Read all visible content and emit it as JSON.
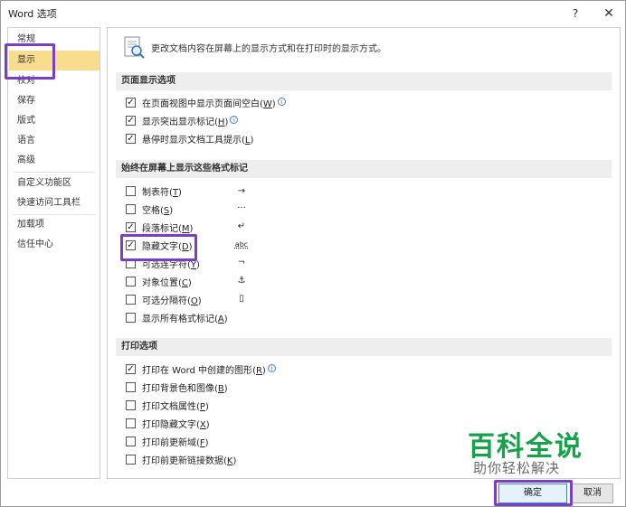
{
  "window": {
    "title": "Word 选项",
    "help_label": "?",
    "close_label": "✕"
  },
  "sidebar": {
    "items": [
      {
        "label": "常规"
      },
      {
        "label": "显示"
      },
      {
        "label": "校对"
      },
      {
        "label": "保存"
      },
      {
        "label": "版式"
      },
      {
        "label": "语言"
      },
      {
        "label": "高级"
      },
      {
        "label": "自定义功能区"
      },
      {
        "label": "快速访问工具栏"
      },
      {
        "label": "加载项"
      },
      {
        "label": "信任中心"
      }
    ],
    "selected": "显示"
  },
  "main": {
    "intro": "更改文档内容在屏幕上的显示方式和在打印时的显示方式。",
    "sections": [
      {
        "title": "页面显示选项",
        "options": [
          {
            "label": "在页面视图中显示页面间空白",
            "key": "W",
            "checked": true,
            "info": true
          },
          {
            "label": "显示突出显示标记",
            "key": "H",
            "checked": true,
            "info": true
          },
          {
            "label": "悬停时显示文档工具提示",
            "key": "L",
            "checked": true,
            "info": false
          }
        ]
      },
      {
        "title": "始终在屏幕上显示这些格式标记",
        "options": [
          {
            "label": "制表符",
            "key": "T",
            "checked": false,
            "symbol": "→"
          },
          {
            "label": "空格",
            "key": "S",
            "checked": false,
            "symbol": "···"
          },
          {
            "label": "段落标记",
            "key": "M",
            "checked": true,
            "symbol": "↵"
          },
          {
            "label": "隐藏文字",
            "key": "D",
            "checked": true,
            "symbol": "abc"
          },
          {
            "label": "可选连字符",
            "key": "Y",
            "checked": false,
            "symbol": "¬"
          },
          {
            "label": "对象位置",
            "key": "C",
            "checked": false,
            "symbol": "⚓"
          },
          {
            "label": "可选分隔符",
            "key": "O",
            "checked": false,
            "symbol": "▯"
          },
          {
            "label": "显示所有格式标记",
            "key": "A",
            "checked": false
          }
        ]
      },
      {
        "title": "打印选项",
        "options": [
          {
            "label": "打印在 Word 中创建的图形",
            "key": "R",
            "checked": true,
            "info": true
          },
          {
            "label": "打印背景色和图像",
            "key": "B",
            "checked": false
          },
          {
            "label": "打印文档属性",
            "key": "P",
            "checked": false
          },
          {
            "label": "打印隐藏文字",
            "key": "X",
            "checked": false
          },
          {
            "label": "打印前更新域",
            "key": "F",
            "checked": false
          },
          {
            "label": "打印前更新链接数据",
            "key": "K",
            "checked": false
          }
        ]
      }
    ]
  },
  "buttons": {
    "ok": "确定",
    "cancel": "取消"
  },
  "watermark": {
    "title": "百科全说",
    "subtitle": "助你轻松解决"
  },
  "colors": {
    "selected_bg": "#f9dd8f",
    "highlight": "#7b3fc4",
    "watermark": "#15a34a"
  }
}
